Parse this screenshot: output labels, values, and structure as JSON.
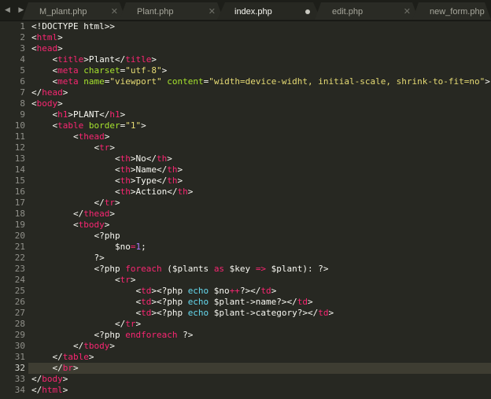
{
  "tabs": [
    {
      "label": "M_plant.php",
      "state": "inactive"
    },
    {
      "label": "Plant.php",
      "state": "inactive"
    },
    {
      "label": "index.php",
      "state": "active",
      "dirty": true
    },
    {
      "label": "edit.php",
      "state": "inactive"
    },
    {
      "label": "new_form.php",
      "state": "inactive"
    }
  ],
  "current_line": 32,
  "colors": {
    "background": "#272822",
    "tag": "#f92672",
    "attribute": "#a6e22e",
    "string": "#e6db74",
    "keyword_blue": "#66d9ef",
    "number": "#ae81ff",
    "text": "#f8f8f2"
  },
  "lines": [
    [
      {
        "t": "<!DOCTYPE html>",
        "c": "text"
      },
      {
        "t": ">",
        "c": "text"
      }
    ],
    [
      {
        "t": "<",
        "c": "text"
      },
      {
        "t": "html",
        "c": "tag"
      },
      {
        "t": ">",
        "c": "text"
      }
    ],
    [
      {
        "t": "<",
        "c": "text"
      },
      {
        "t": "head",
        "c": "tag"
      },
      {
        "t": ">",
        "c": "text"
      }
    ],
    [
      {
        "t": "    <",
        "c": "text"
      },
      {
        "t": "title",
        "c": "tag"
      },
      {
        "t": ">Plant</",
        "c": "text"
      },
      {
        "t": "title",
        "c": "tag"
      },
      {
        "t": ">",
        "c": "text"
      }
    ],
    [
      {
        "t": "    <",
        "c": "text"
      },
      {
        "t": "meta",
        "c": "tag"
      },
      {
        "t": " ",
        "c": "text"
      },
      {
        "t": "charset",
        "c": "attr"
      },
      {
        "t": "=",
        "c": "text"
      },
      {
        "t": "\"utf-8\"",
        "c": "string"
      },
      {
        "t": ">",
        "c": "text"
      }
    ],
    [
      {
        "t": "    <",
        "c": "text"
      },
      {
        "t": "meta",
        "c": "tag"
      },
      {
        "t": " ",
        "c": "text"
      },
      {
        "t": "name",
        "c": "attr"
      },
      {
        "t": "=",
        "c": "text"
      },
      {
        "t": "\"viewport\"",
        "c": "string"
      },
      {
        "t": " ",
        "c": "text"
      },
      {
        "t": "content",
        "c": "attr"
      },
      {
        "t": "=",
        "c": "text"
      },
      {
        "t": "\"width=device-widht, initial-scale, shrink-to-fit=no\"",
        "c": "string"
      },
      {
        "t": ">",
        "c": "text"
      }
    ],
    [
      {
        "t": "</",
        "c": "text"
      },
      {
        "t": "head",
        "c": "tag"
      },
      {
        "t": ">",
        "c": "text"
      }
    ],
    [
      {
        "t": "<",
        "c": "text"
      },
      {
        "t": "body",
        "c": "tag"
      },
      {
        "t": ">",
        "c": "text"
      }
    ],
    [
      {
        "t": "    <",
        "c": "text"
      },
      {
        "t": "h1",
        "c": "tag"
      },
      {
        "t": ">PLANT</",
        "c": "text"
      },
      {
        "t": "h1",
        "c": "tag"
      },
      {
        "t": ">",
        "c": "text"
      }
    ],
    [
      {
        "t": "    <",
        "c": "text"
      },
      {
        "t": "table",
        "c": "tag"
      },
      {
        "t": " ",
        "c": "text"
      },
      {
        "t": "border",
        "c": "attr"
      },
      {
        "t": "=",
        "c": "text"
      },
      {
        "t": "\"1\"",
        "c": "string"
      },
      {
        "t": ">",
        "c": "text"
      }
    ],
    [
      {
        "t": "        <",
        "c": "text"
      },
      {
        "t": "thead",
        "c": "tag"
      },
      {
        "t": ">",
        "c": "text"
      }
    ],
    [
      {
        "t": "            <",
        "c": "text"
      },
      {
        "t": "tr",
        "c": "tag"
      },
      {
        "t": ">",
        "c": "text"
      }
    ],
    [
      {
        "t": "                <",
        "c": "text"
      },
      {
        "t": "th",
        "c": "tag"
      },
      {
        "t": ">No</",
        "c": "text"
      },
      {
        "t": "th",
        "c": "tag"
      },
      {
        "t": ">",
        "c": "text"
      }
    ],
    [
      {
        "t": "                <",
        "c": "text"
      },
      {
        "t": "th",
        "c": "tag"
      },
      {
        "t": ">Name</",
        "c": "text"
      },
      {
        "t": "th",
        "c": "tag"
      },
      {
        "t": ">",
        "c": "text"
      }
    ],
    [
      {
        "t": "                <",
        "c": "text"
      },
      {
        "t": "th",
        "c": "tag"
      },
      {
        "t": ">Type</",
        "c": "text"
      },
      {
        "t": "th",
        "c": "tag"
      },
      {
        "t": ">",
        "c": "text"
      }
    ],
    [
      {
        "t": "                <",
        "c": "text"
      },
      {
        "t": "th",
        "c": "tag"
      },
      {
        "t": ">Action</",
        "c": "text"
      },
      {
        "t": "th",
        "c": "tag"
      },
      {
        "t": ">",
        "c": "text"
      }
    ],
    [
      {
        "t": "            </",
        "c": "text"
      },
      {
        "t": "tr",
        "c": "tag"
      },
      {
        "t": ">",
        "c": "text"
      }
    ],
    [
      {
        "t": "        </",
        "c": "text"
      },
      {
        "t": "thead",
        "c": "tag"
      },
      {
        "t": ">",
        "c": "text"
      }
    ],
    [
      {
        "t": "        <",
        "c": "text"
      },
      {
        "t": "tbody",
        "c": "tag"
      },
      {
        "t": ">",
        "c": "text"
      }
    ],
    [
      {
        "t": "            <?php",
        "c": "text"
      }
    ],
    [
      {
        "t": "                $no",
        "c": "text"
      },
      {
        "t": "=",
        "c": "tag"
      },
      {
        "t": "1",
        "c": "number"
      },
      {
        "t": ";",
        "c": "text"
      }
    ],
    [
      {
        "t": "            ?>",
        "c": "text"
      }
    ],
    [
      {
        "t": "            <?php ",
        "c": "text"
      },
      {
        "t": "foreach",
        "c": "tag"
      },
      {
        "t": " ($plants ",
        "c": "text"
      },
      {
        "t": "as",
        "c": "tag"
      },
      {
        "t": " $key ",
        "c": "text"
      },
      {
        "t": "=>",
        "c": "tag"
      },
      {
        "t": " $plant): ?>",
        "c": "text"
      }
    ],
    [
      {
        "t": "                <",
        "c": "text"
      },
      {
        "t": "tr",
        "c": "tag"
      },
      {
        "t": ">",
        "c": "text"
      }
    ],
    [
      {
        "t": "                    <",
        "c": "text"
      },
      {
        "t": "td",
        "c": "tag"
      },
      {
        "t": "><?php ",
        "c": "text"
      },
      {
        "t": "echo",
        "c": "func"
      },
      {
        "t": " $no",
        "c": "text"
      },
      {
        "t": "++",
        "c": "tag"
      },
      {
        "t": "?></",
        "c": "text"
      },
      {
        "t": "td",
        "c": "tag"
      },
      {
        "t": ">",
        "c": "text"
      }
    ],
    [
      {
        "t": "                    <",
        "c": "text"
      },
      {
        "t": "td",
        "c": "tag"
      },
      {
        "t": "><?php ",
        "c": "text"
      },
      {
        "t": "echo",
        "c": "func"
      },
      {
        "t": " $plant->name?></",
        "c": "text"
      },
      {
        "t": "td",
        "c": "tag"
      },
      {
        "t": ">",
        "c": "text"
      }
    ],
    [
      {
        "t": "                    <",
        "c": "text"
      },
      {
        "t": "td",
        "c": "tag"
      },
      {
        "t": "><?php ",
        "c": "text"
      },
      {
        "t": "echo",
        "c": "func"
      },
      {
        "t": " $plant->category?></",
        "c": "text"
      },
      {
        "t": "td",
        "c": "tag"
      },
      {
        "t": ">",
        "c": "text"
      }
    ],
    [
      {
        "t": "                </",
        "c": "text"
      },
      {
        "t": "tr",
        "c": "tag"
      },
      {
        "t": ">",
        "c": "text"
      }
    ],
    [
      {
        "t": "            <?php ",
        "c": "text"
      },
      {
        "t": "endforeach",
        "c": "tag"
      },
      {
        "t": " ?>",
        "c": "text"
      }
    ],
    [
      {
        "t": "        </",
        "c": "text"
      },
      {
        "t": "tbody",
        "c": "tag"
      },
      {
        "t": ">",
        "c": "text"
      }
    ],
    [
      {
        "t": "    </",
        "c": "text"
      },
      {
        "t": "table",
        "c": "tag"
      },
      {
        "t": ">",
        "c": "text"
      }
    ],
    [
      {
        "t": "    </",
        "c": "text"
      },
      {
        "t": "br",
        "c": "tag"
      },
      {
        "t": ">",
        "c": "text"
      }
    ],
    [
      {
        "t": "</",
        "c": "text"
      },
      {
        "t": "body",
        "c": "tag"
      },
      {
        "t": ">",
        "c": "text"
      }
    ],
    [
      {
        "t": "</",
        "c": "text"
      },
      {
        "t": "html",
        "c": "tag"
      },
      {
        "t": ">",
        "c": "text"
      }
    ]
  ]
}
